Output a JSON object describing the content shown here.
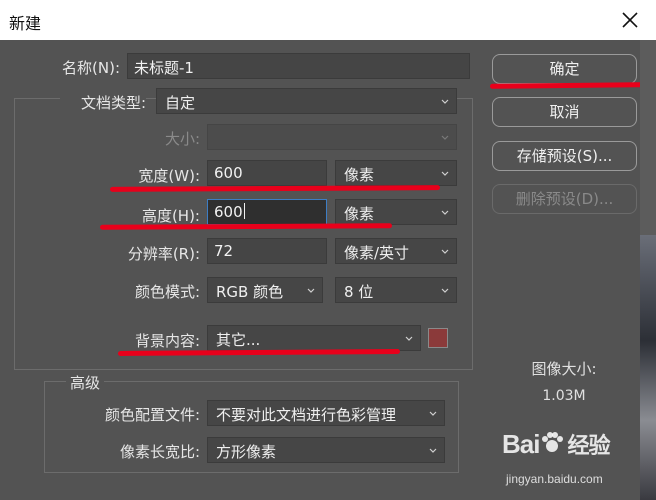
{
  "window": {
    "title": "新建"
  },
  "form": {
    "name_label": "名称(N):",
    "name_value": "未标题-1",
    "doc_type_label": "文档类型:",
    "doc_type_value": "自定",
    "size_label": "大小:",
    "size_value": "",
    "width_label": "宽度(W):",
    "width_value": "600",
    "width_unit": "像素",
    "height_label": "高度(H):",
    "height_value": "600",
    "height_unit": "像素",
    "resolution_label": "分辨率(R):",
    "resolution_value": "72",
    "resolution_unit": "像素/英寸",
    "color_mode_label": "颜色模式:",
    "color_mode_value": "RGB 颜色",
    "bit_depth_value": "8 位",
    "background_label": "背景内容:",
    "background_value": "其它...",
    "background_swatch_color": "#8b3a3a"
  },
  "advanced": {
    "title": "高级",
    "profile_label": "颜色配置文件:",
    "profile_value": "不要对此文档进行色彩管理",
    "pixel_aspect_label": "像素长宽比:",
    "pixel_aspect_value": "方形像素"
  },
  "buttons": {
    "ok": "确定",
    "cancel": "取消",
    "save_preset": "存储预设(S)...",
    "delete_preset": "删除预设(D)..."
  },
  "image_size": {
    "label": "图像大小:",
    "value": "1.03M"
  },
  "watermark": {
    "brand": "Bai",
    "brand_cn": "经验",
    "url": "jingyan.baidu.com"
  },
  "colors": {
    "annotation_red": "#e8001b",
    "focus_blue": "#3d7dc4"
  }
}
